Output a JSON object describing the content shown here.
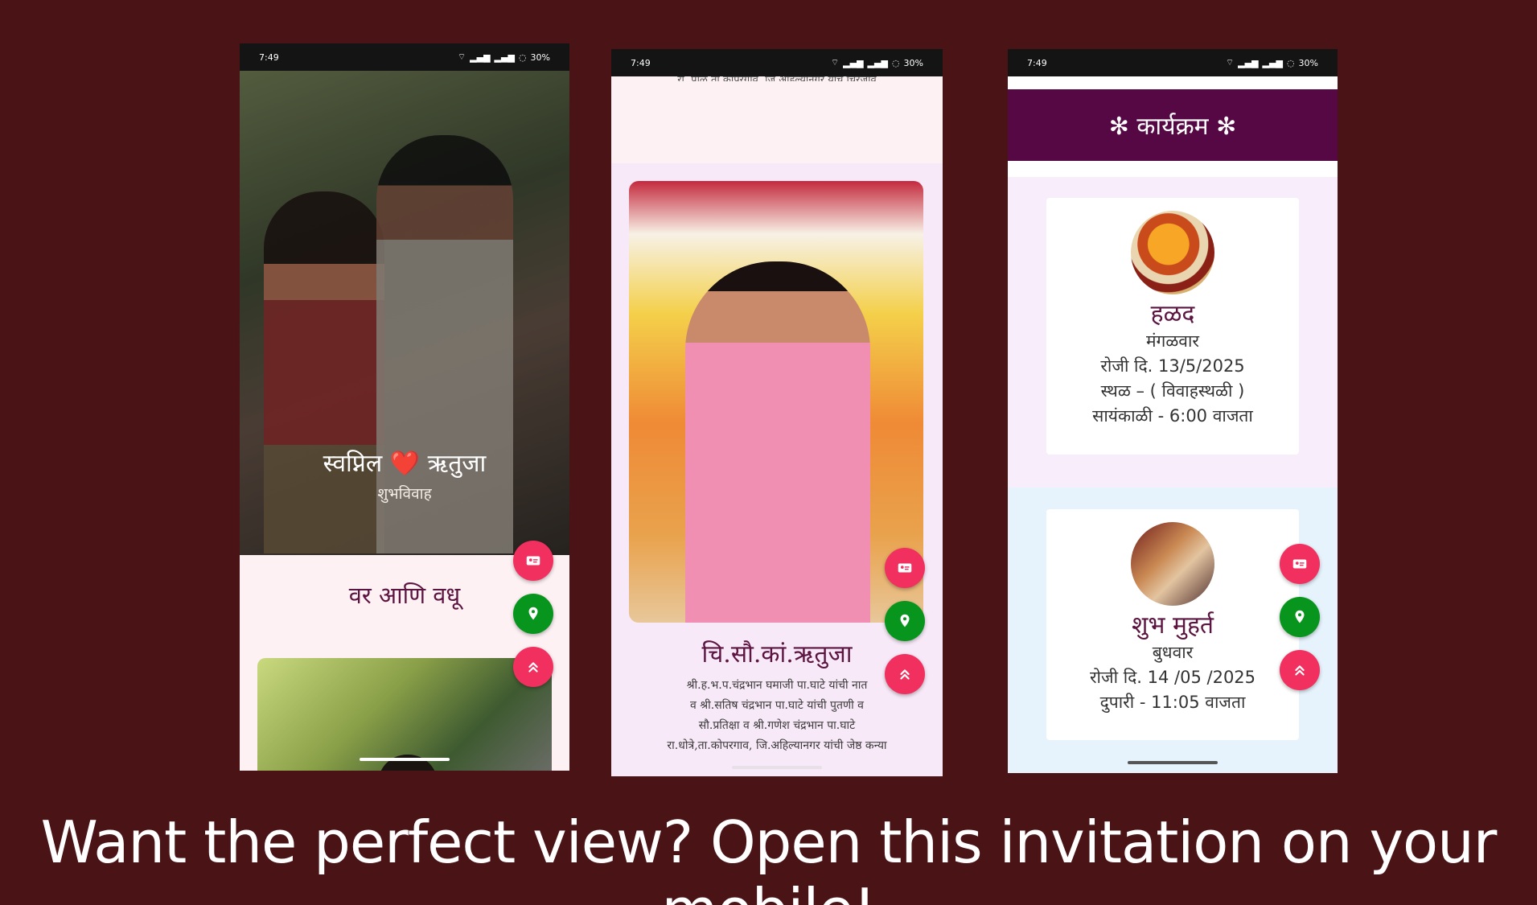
{
  "status": {
    "time": "7:49",
    "battery": "30%"
  },
  "phone1": {
    "couple_names": "स्वप्निल ❤️ ऋतुजा",
    "subtitle": "शुभविवाह",
    "section_title": "वर आणि वधू"
  },
  "phone2": {
    "cut_text": "रा. पाळ,ता.कोपरगाव, जि.अहिल्यानगर यांचे चिरंजीव",
    "bride_name": "चि.सौ.कां.ऋतुजा",
    "parents_lines": [
      "श्री.ह.भ.प.चंद्रभान घमाजी पा.घाटे यांची नात",
      "व श्री.सतिष चंद्रभान पा.घाटे यांची पुतणी व",
      "सौ.प्रतिक्षा व श्री.गणेश चंद्रभान पा.घाटे",
      "रा.धोत्रे,ता.कोपरगाव, जि.अहिल्यानगर यांची जेष्ठ कन्या"
    ]
  },
  "phone3": {
    "header": "✻ कार्यक्रम ✻",
    "events": [
      {
        "title": "हळद",
        "day": "मंगळवार",
        "date": "रोजी दि. 13/5/2025",
        "place": "स्थळ – ( विवाहस्थळी )",
        "time": "सायंकाळी - 6:00 वाजता"
      },
      {
        "title": "शुभ मुहर्त",
        "day": "बुधवार",
        "date": "रोजी दि. 14 /05 /2025",
        "time": "दुपारी - 11:05 वाजता"
      }
    ]
  },
  "fab_icons": [
    "contact-card-icon",
    "location-pin-icon",
    "double-chevron-up-icon"
  ],
  "colors": {
    "background": "#4a1416",
    "accent_pink": "#f2305f",
    "accent_green": "#08951d",
    "header_purple": "#560845",
    "title_purple": "#5c1440"
  },
  "banner": "Want the perfect view? Open this invitation on your mobile!"
}
